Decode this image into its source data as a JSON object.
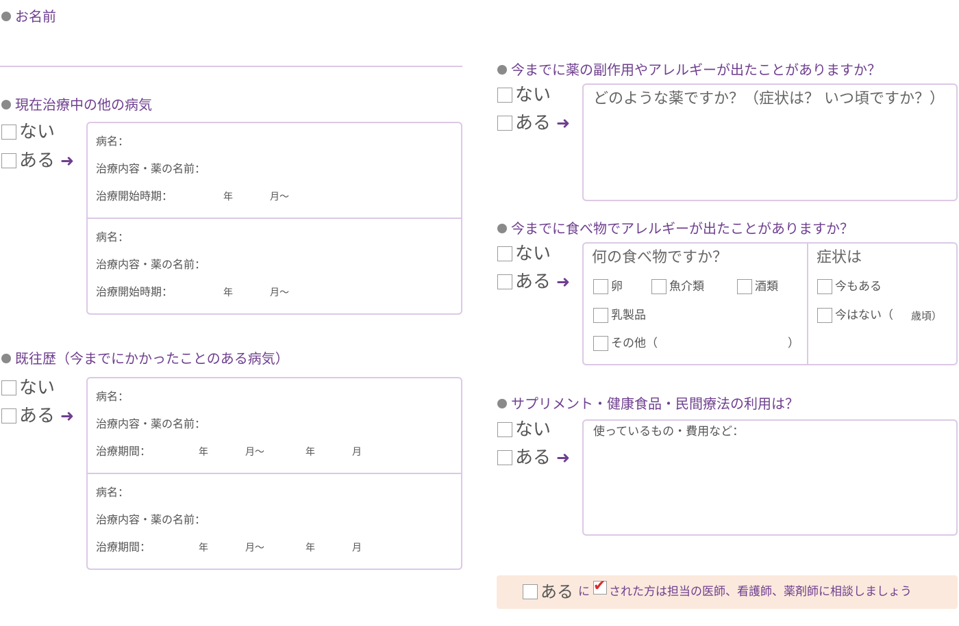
{
  "name_section": {
    "title": "お名前"
  },
  "yes_no": {
    "no": "ない",
    "yes": "ある",
    "arrow": "➜"
  },
  "current_illness": {
    "title": "現在治療中の他の病気",
    "entries": [
      {
        "disease": "病名：",
        "treatment": "治療内容・薬の名前：",
        "start": "治療開始時期：",
        "year": "年",
        "month": "月～"
      },
      {
        "disease": "病名：",
        "treatment": "治療内容・薬の名前：",
        "start": "治療開始時期：",
        "year": "年",
        "month": "月～"
      }
    ]
  },
  "past_history": {
    "title": "既往歴（今までにかかったことのある病気）",
    "entries": [
      {
        "disease": "病名：",
        "treatment": "治療内容・薬の名前：",
        "period": "治療期間：",
        "year1": "年",
        "month1": "月～",
        "year2": "年",
        "month2": "月"
      },
      {
        "disease": "病名：",
        "treatment": "治療内容・薬の名前：",
        "period": "治療期間：",
        "year1": "年",
        "month1": "月～",
        "year2": "年",
        "month2": "月"
      }
    ]
  },
  "drug_allergy": {
    "title": "今までに薬の副作用やアレルギーが出たことがありますか？",
    "prompt": "どのような薬ですか？（症状は？ いつ頃ですか？）"
  },
  "food_allergy": {
    "title": "今までに食べ物でアレルギーが出たことがありますか？",
    "question": "何の食べ物ですか？",
    "options": {
      "egg": "卵",
      "seafood": "魚介類",
      "alcohol": "酒類",
      "dairy": "乳製品",
      "other": "その他（",
      "other_close": "）"
    },
    "symptom_title": "症状は",
    "symptoms": {
      "still": "今もある",
      "none": "今はない（",
      "age": "歳頃）"
    }
  },
  "supplements": {
    "title": "サプリメント・健康食品・民間療法の利用は？",
    "prompt": "使っているもの・費用など："
  },
  "footer_note": {
    "yes": "ある",
    "ni": "に",
    "check": "✔",
    "text": "された方は担当の医師、看護師、薬剤師に相談しましょう"
  },
  "colors": {
    "accent": "#6f3f8f",
    "border": "#dcc8e6",
    "note_bg": "#fbe9dd",
    "check": "#d62b2b"
  }
}
